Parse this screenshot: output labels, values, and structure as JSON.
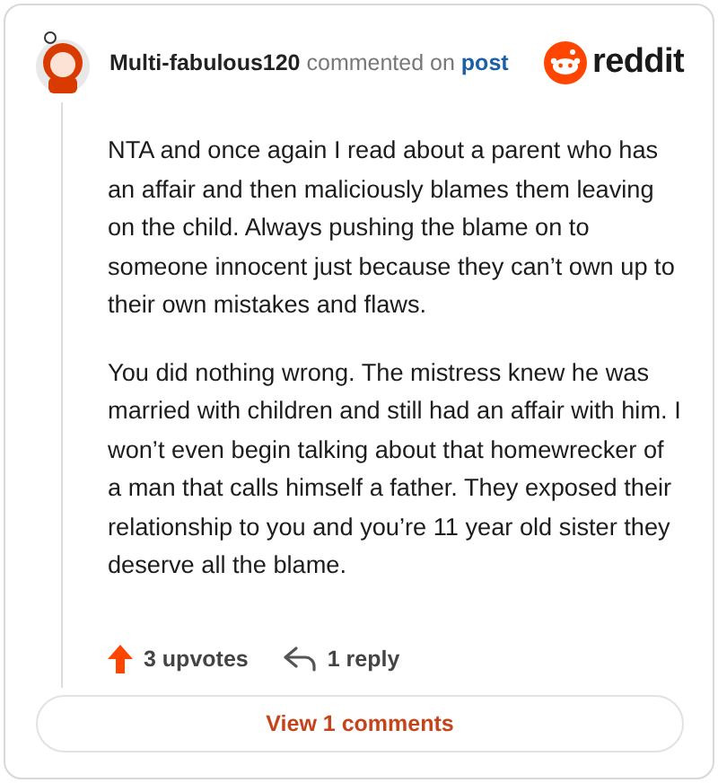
{
  "comment": {
    "author": "Multi-fabulous120",
    "action": "commented on",
    "target": "post"
  },
  "brand": "reddit",
  "paragraphs": [
    "NTA and once again I read about a parent who has an affair and then maliciously blames them leaving on the child. Always pushing the blame on to someone innocent just because they can’t own up to their own mistakes and flaws.",
    "You did nothing wrong. The mistress knew he was married with children and still had an affair with him. I won’t even begin talking about that homewrecker of a man that calls himself a father. They exposed their relationship to you and you’re 11 year old sister they deserve all the blame."
  ],
  "upvotes": "3 upvotes",
  "replies": "1 reply",
  "view_button": "View 1 comments"
}
